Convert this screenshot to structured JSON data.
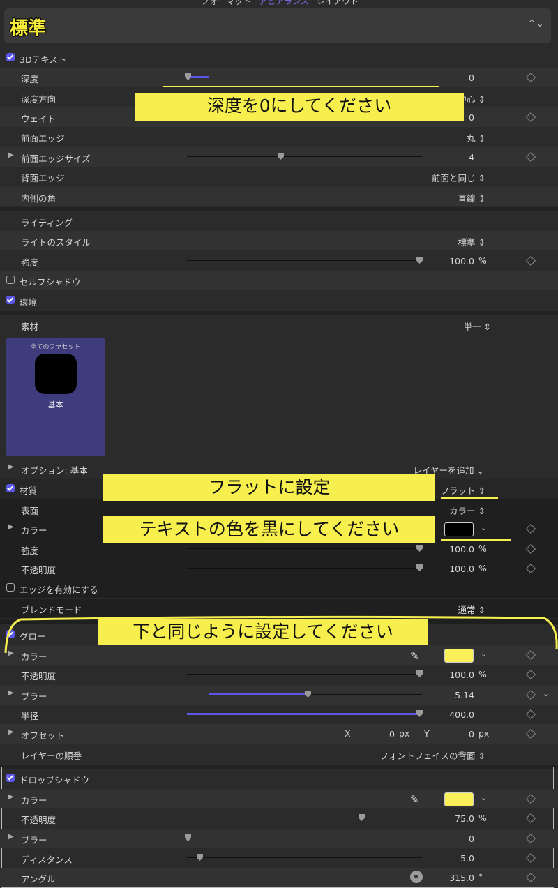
{
  "tabs": {
    "format": "フォーマット",
    "appearance": "アピアランス",
    "layout": "レイアウト"
  },
  "preset": {
    "title": "標準"
  },
  "text3d": {
    "label": "3Dテキスト",
    "depth": {
      "label": "深度",
      "value": "0",
      "fraction": 0.0
    },
    "depth_direction": {
      "label": "深度方向",
      "value": "中心"
    },
    "weight": {
      "label": "ウェイト",
      "value": "0"
    },
    "front_edge": {
      "label": "前面エッジ",
      "value": "丸"
    },
    "front_edge_size": {
      "label": "前面エッジサイズ",
      "value": "4",
      "fraction": 0.4
    },
    "back_edge": {
      "label": "背面エッジ",
      "value": "前面と同じ"
    },
    "inner_corner": {
      "label": "内側の角",
      "value": "直線"
    }
  },
  "lighting": {
    "section": "ライティング",
    "light_style": {
      "label": "ライトのスタイル",
      "value": "標準"
    },
    "intensity": {
      "label": "強度",
      "value": "100.0",
      "unit": "%",
      "fraction": 1.0
    },
    "self_shadow": "セルフシャドウ",
    "environment": "環境"
  },
  "material": {
    "label": "素材",
    "mode": "単一",
    "facet_header": "全てのファセット",
    "facet_name": "基本",
    "options": "オプション: 基本",
    "add_layer": "レイヤーを追加",
    "quality": {
      "label": "材質",
      "value": "フラット"
    },
    "surface": {
      "label": "表面",
      "value": "カラー"
    },
    "color": {
      "label": "カラー",
      "swatch": "#000000"
    },
    "intensity": {
      "label": "強度",
      "value": "100.0",
      "unit": "%",
      "fraction": 1.0
    },
    "opacity": {
      "label": "不透明度",
      "value": "100.0",
      "unit": "%",
      "fraction": 1.0
    },
    "enable_edges": "エッジを有効にする",
    "blend_mode": {
      "label": "ブレンドモード",
      "value": "通常"
    }
  },
  "glow": {
    "label": "グロー",
    "color": {
      "label": "カラー",
      "swatch": "#fbf05a"
    },
    "opacity": {
      "label": "不透明度",
      "value": "100.0",
      "unit": "%",
      "fraction": 1.0
    },
    "blur": {
      "label": "ブラー",
      "value": "5.14",
      "fraction": 0.51
    },
    "radius": {
      "label": "半径",
      "value": "400.0",
      "fraction": 1.0
    },
    "offset": {
      "label": "オフセット",
      "x_label": "X",
      "x_value": "0",
      "y_label": "Y",
      "y_value": "0",
      "unit": "px"
    },
    "layer_order": {
      "label": "レイヤーの順番",
      "value": "フォントフェイスの背面"
    }
  },
  "drop_shadow": {
    "label": "ドロップシャドウ",
    "color": {
      "label": "カラー",
      "swatch": "#fbf05a"
    },
    "opacity": {
      "label": "不透明度",
      "value": "75.0",
      "unit": "%",
      "fraction": 0.75
    },
    "blur": {
      "label": "ブラー",
      "value": "0",
      "fraction": 0.0
    },
    "distance": {
      "label": "ディスタンス",
      "value": "5.0",
      "fraction": 0.05
    },
    "angle": {
      "label": "アングル",
      "value": "315.0",
      "unit": "°"
    }
  },
  "annotations": {
    "depth_note": "深度を0にしてください",
    "flat_note": "フラットに設定",
    "color_note": "テキストの色を黒にしてください",
    "glow_note": "下と同じように設定してください"
  },
  "icons": {
    "checkbox": "checkbox-icon",
    "disclosure": "disclosure-triangle-icon",
    "keyframe": "keyframe-diamond-icon",
    "eyedropper": "eyedropper-icon",
    "updown": "updown-chevron-icon"
  }
}
